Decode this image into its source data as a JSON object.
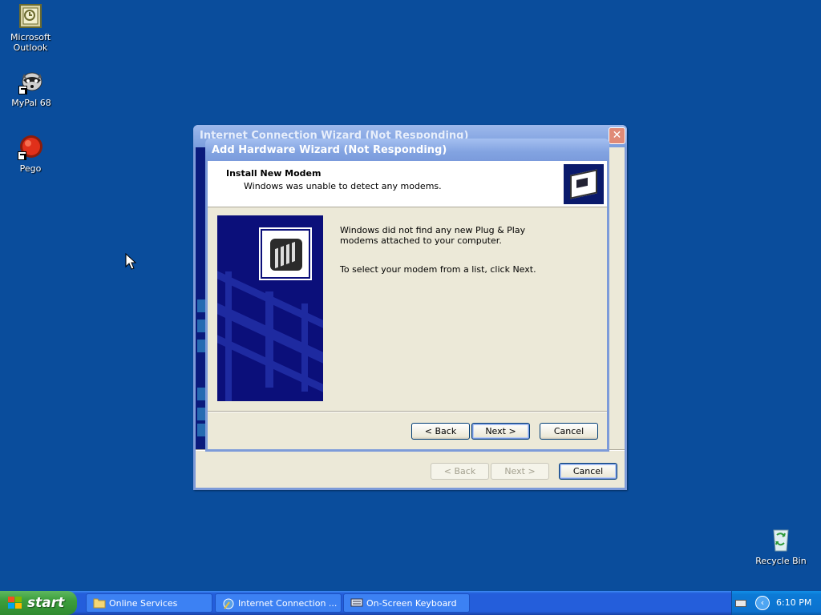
{
  "desktop": {
    "icons": [
      {
        "label": "Microsoft\nOutlook"
      },
      {
        "label": "MyPal 68"
      },
      {
        "label": "Pego"
      },
      {
        "label": "Recycle Bin"
      }
    ]
  },
  "back_window": {
    "title": "Internet Connection Wizard (Not Responding)",
    "close_glyph": "✕",
    "back_label": "< Back",
    "next_label": "Next >",
    "cancel_label": "Cancel"
  },
  "front_window": {
    "title": "Add Hardware Wizard (Not Responding)",
    "header_title": "Install New Modem",
    "header_subtitle": "Windows was unable to detect any modems.",
    "body_line1": "Windows did not find any new Plug & Play modems attached to your computer.",
    "body_line2": "To select your modem from a list, click Next.",
    "back_label": "< Back",
    "next_label": "Next >",
    "cancel_label": "Cancel"
  },
  "taskbar": {
    "start_label": "start",
    "tasks": [
      {
        "label": "Online Services",
        "icon": "folder-icon"
      },
      {
        "label": "Internet Connection ...",
        "icon": "wizard-icon"
      },
      {
        "label": "On-Screen Keyboard",
        "icon": "keyboard-icon"
      }
    ],
    "tray_arrow": "‹",
    "clock": "6:10 PM"
  },
  "colors": {
    "desktop": "#0a4d9c",
    "taskbar": "#245edb",
    "start": "#3c9e3c",
    "window_face": "#ece9d8"
  }
}
